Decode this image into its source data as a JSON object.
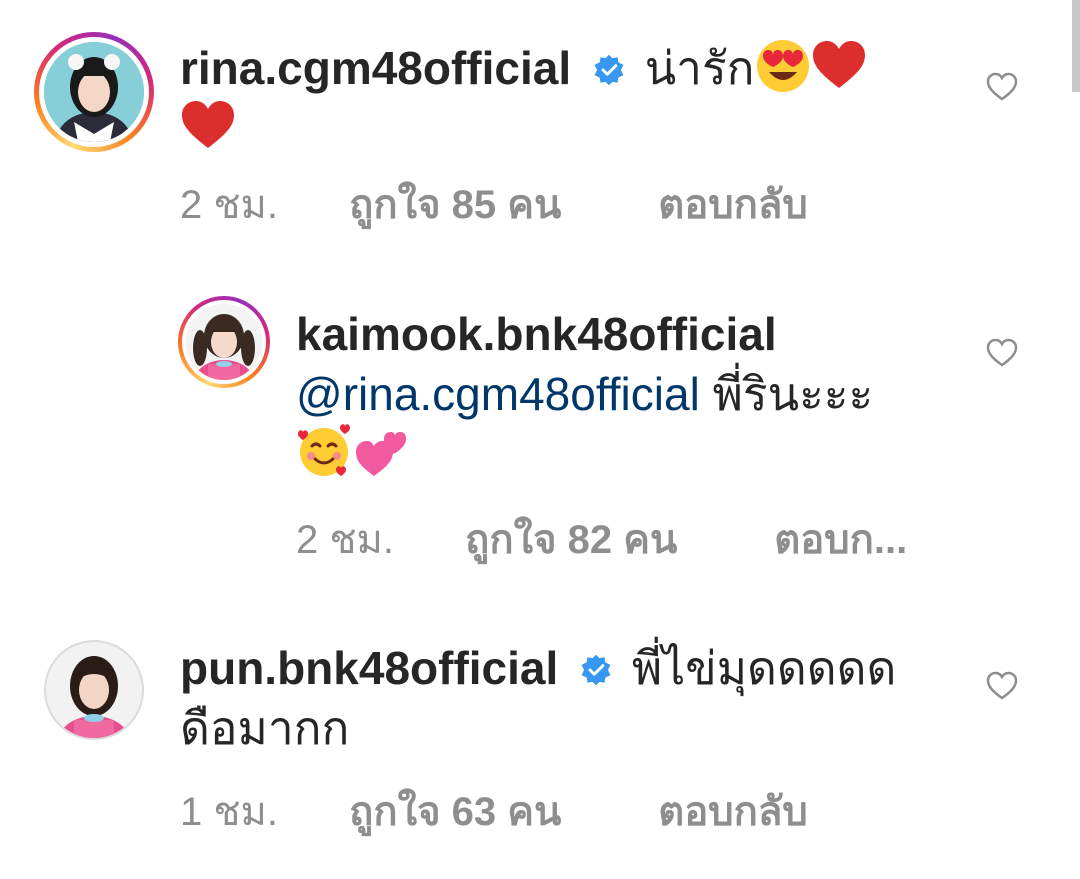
{
  "comments": [
    {
      "username": "rina.cgm48official",
      "verified": true,
      "text": "น่ารัก",
      "emojis": [
        "heart-eyes-emoji",
        "red-heart-emoji",
        "red-heart-emoji"
      ],
      "time": "2 ชม.",
      "likes": "ถูกใจ 85 คน",
      "reply": "ตอบกลับ"
    },
    {
      "username": "kaimook.bnk48official",
      "verified": false,
      "mention": "@rina.cgm48official",
      "text": "พี่รินะะะ",
      "emojis": [
        "smiling-face-with-hearts-emoji",
        "two-hearts-emoji"
      ],
      "time": "2 ชม.",
      "likes": "ถูกใจ 82 คน",
      "reply": "ตอบก..."
    },
    {
      "username": "pun.bnk48official",
      "verified": true,
      "text": "พี่ไข่มุดดดดด",
      "text_line2": "ดือมากก",
      "time": "1 ชม.",
      "likes": "ถูกใจ 63 คน",
      "reply": "ตอบกลับ"
    }
  ],
  "colors": {
    "verified_blue": "#3897f0",
    "mention": "#00376b",
    "meta_gray": "#8e8e8e",
    "text": "#262626"
  }
}
